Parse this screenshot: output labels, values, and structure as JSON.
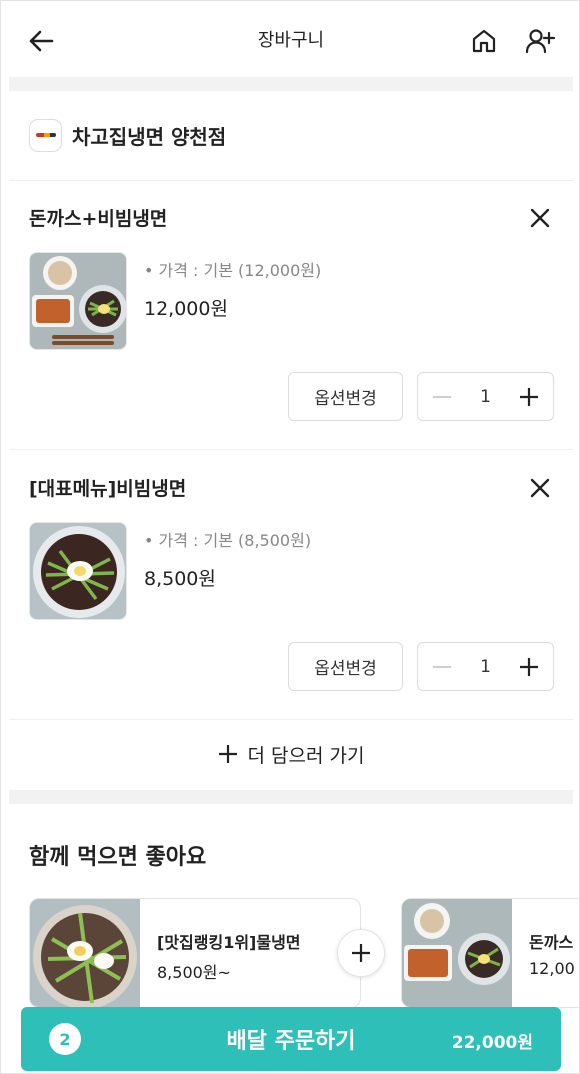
{
  "header": {
    "title": "장바구니",
    "back_icon": "arrow-left-icon",
    "home_icon": "home-icon",
    "add_user_icon": "user-plus-icon"
  },
  "store": {
    "name": "차고집냉면 양천점"
  },
  "cart_items": [
    {
      "name": "돈까스+비빔냉면",
      "option": "• 가격 : 기본 (12,000원)",
      "price": "12,000원",
      "option_button": "옵션변경",
      "quantity": "1"
    },
    {
      "name": "[대표메뉴]비빔냉면",
      "option": "• 가격 : 기본 (8,500원)",
      "price": "8,500원",
      "option_button": "옵션변경",
      "quantity": "1"
    }
  ],
  "add_more": {
    "label": "더 담으러 가기"
  },
  "recommendations": {
    "title": "함께 먹으면 좋아요",
    "items": [
      {
        "name": "[맛집랭킹1위]물냉면",
        "price": "8,500원~"
      },
      {
        "name": "돈까스",
        "price": "12,00"
      }
    ]
  },
  "order": {
    "count": "2",
    "label": "배달 주문하기",
    "total": "22,000원",
    "color": "#2ebfb9"
  }
}
